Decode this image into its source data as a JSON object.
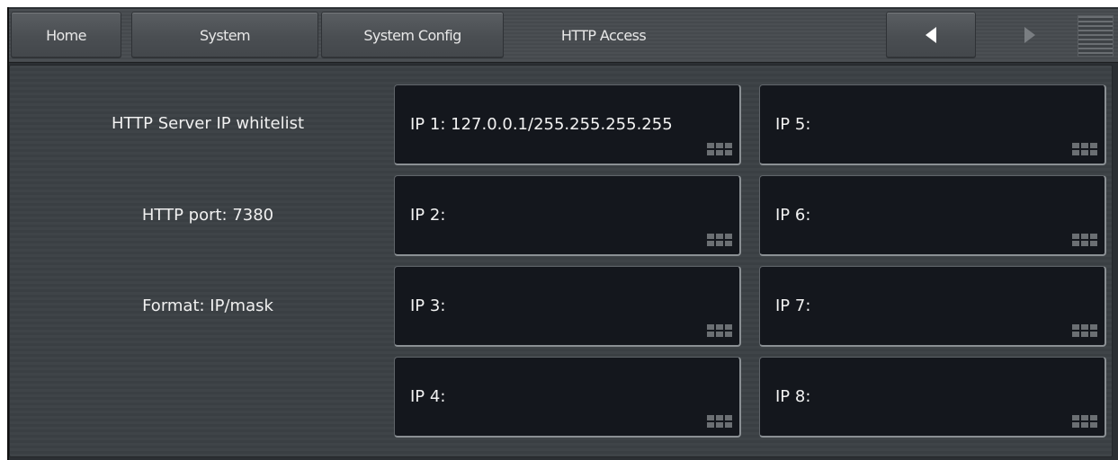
{
  "nav": {
    "tabs": [
      {
        "label": "Home"
      },
      {
        "label": "System"
      },
      {
        "label": "System Config"
      },
      {
        "label": "HTTP Access"
      }
    ],
    "prev_icon": "triangle-left-icon",
    "next_icon": "triangle-right-icon",
    "menu_icon": "menu-lines-icon"
  },
  "info": {
    "whitelist_label": "HTTP Server IP whitelist",
    "port_label": "HTTP port: 7380",
    "format_label": "Format: IP/mask"
  },
  "ip_fields": [
    {
      "label": "IP 1: 127.0.0.1/255.255.255.255"
    },
    {
      "label": "IP 2:"
    },
    {
      "label": "IP 3:"
    },
    {
      "label": "IP 4:"
    },
    {
      "label": "IP 5:"
    },
    {
      "label": "IP 6:"
    },
    {
      "label": "IP 7:"
    },
    {
      "label": "IP 8:"
    }
  ],
  "colors": {
    "background": "#2b2f33",
    "field_bg": "#14171d",
    "text": "#f0f0f0",
    "nav_arrow_active": "#ffffff",
    "nav_arrow_inactive": "#7a7e82"
  }
}
